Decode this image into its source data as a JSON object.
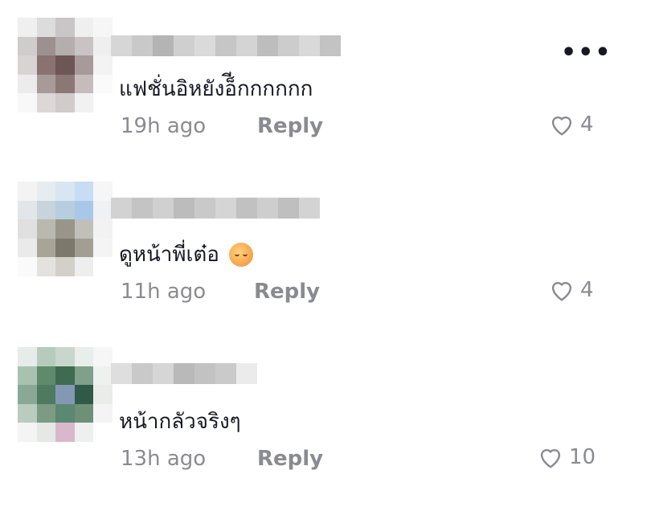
{
  "comments": [
    {
      "text": "แฟชั่นอิหยังอ็ีกกกกกก",
      "time": "19h ago",
      "reply_label": "Reply",
      "likes": "4",
      "has_emoji": false
    },
    {
      "text": "ดูหน้าพี่เต๋อ",
      "time": "11h ago",
      "reply_label": "Reply",
      "likes": "4",
      "has_emoji": true,
      "emoji_name": "woozy-face-emoji"
    },
    {
      "text": "หน้ากลัวจริงๆ",
      "time": "13h ago",
      "reply_label": "Reply",
      "likes": "10",
      "has_emoji": false
    }
  ],
  "more_menu_label": "•••",
  "icons": {
    "like": "heart-outline-icon",
    "more": "more-options-icon"
  },
  "colors": {
    "text": "#161823",
    "secondary": "#8a8b91"
  }
}
